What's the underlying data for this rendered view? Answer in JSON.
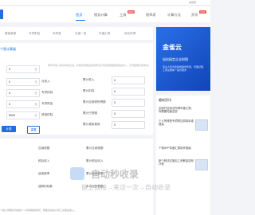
{
  "topbar": {
    "login": "未登录"
  },
  "nav": {
    "items": [
      {
        "label": "首页",
        "active": true
      },
      {
        "label": "税务计算"
      },
      {
        "label": "工具",
        "badge": "NEW"
      },
      {
        "label": "税率表"
      },
      {
        "label": "计算方法"
      },
      {
        "label": "资讯",
        "badge": "HOT"
      }
    ]
  },
  "tabs": [
    "基础参数",
    "专项附加",
    "年终奖",
    "社保一览",
    "年度汇算",
    "综合所得"
  ],
  "calc": {
    "title": "个税计算器",
    "tip": "填写月收入等基本信息后，系统将按照最新税率表计算应纳税额和税后收入，计算结果仅供参考。",
    "fields": [
      {
        "label": "月收入",
        "value": "0",
        "suffix": "元"
      },
      {
        "label": "专项扣除",
        "value": "0",
        "suffix": "元"
      },
      {
        "label": "专项附加",
        "value": "0",
        "suffix": "元"
      },
      {
        "label": "其他扣除",
        "value": "0",
        "suffix": "元"
      },
      {
        "label": "起征点",
        "value": "5000",
        "suffix": "元"
      }
    ],
    "right_labels": [
      "累计收入",
      "累计扣除",
      "累计应纳税所得额",
      "累计已预缴",
      "累计减除费用"
    ],
    "right_values": [
      "0",
      "0",
      "0",
      "0",
      "0"
    ],
    "buttons": {
      "calc": "计算",
      "reset": "重置"
    }
  },
  "result": {
    "labels": [
      "应纳税额",
      "税后收入",
      "适用税率",
      "速算扣除数"
    ],
    "right_labels": [
      "累计应纳税额",
      "累计税后收入",
      "累计适用税率",
      "本月应补税额"
    ]
  },
  "side": {
    "ad_brand": "金雀云",
    "ad_sub": "轻松搞定企业财税",
    "ad_desc": "专业人员为您提供税务筹划、代理记账、工商注册等一站式服务",
    "news_header": "最新资讯",
    "articles": [
      "全面开征综合所得年度汇算，你需要知道这些",
      "个人所得税专项附加扣除标准提高",
      "个税APP年度汇算操作指南",
      "新个税法实施后工资薪金如何计税"
    ]
  },
  "watermark": {
    "big": "自动秒收录",
    "small": "做上链接→来访一次→自动收录"
  },
  "footer": {
    "desc": "个税计算器支持最新个人所得税税率表，帮助您快速计算工资税后收入。"
  }
}
